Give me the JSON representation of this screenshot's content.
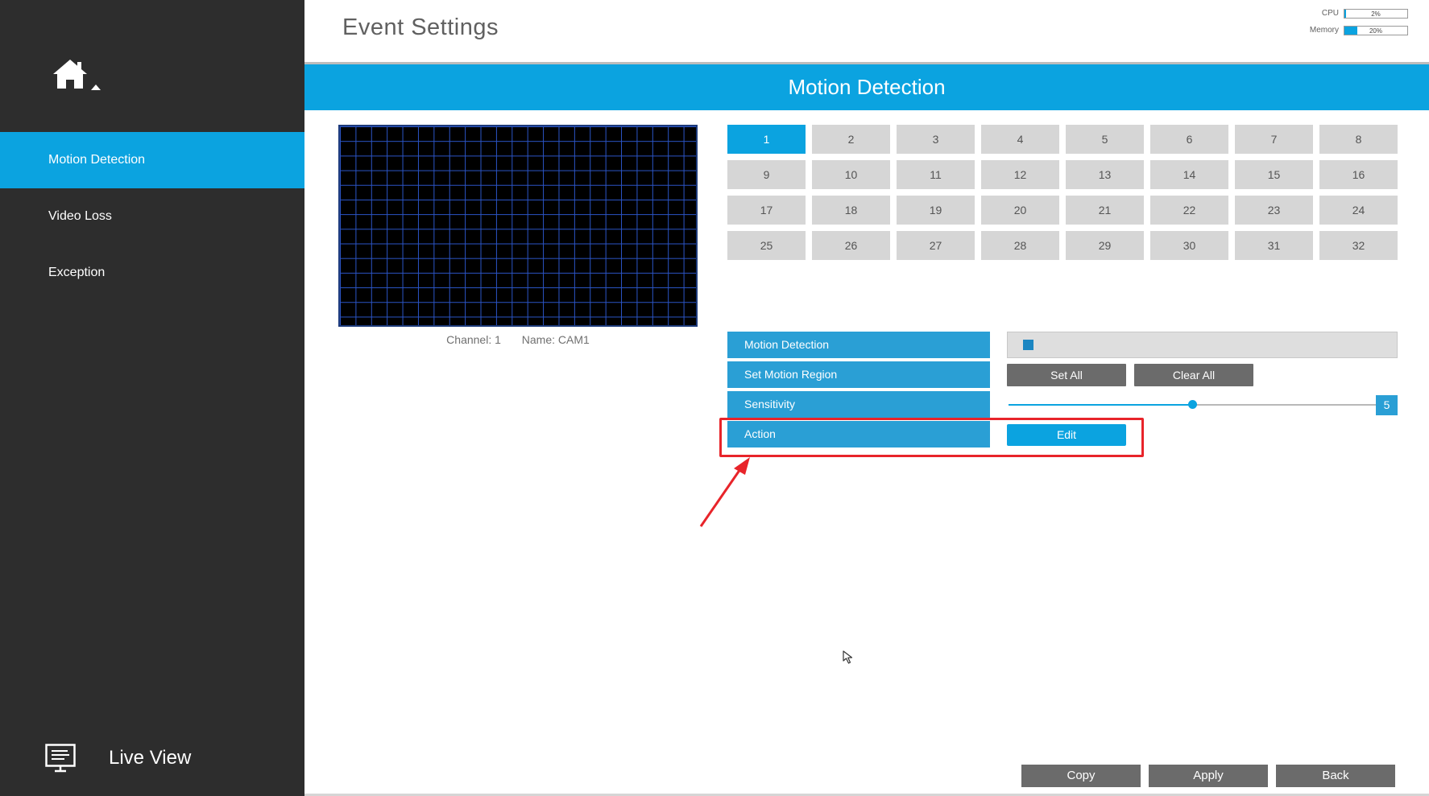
{
  "sidebar": {
    "home_icon": "home-icon",
    "items": [
      {
        "label": "Motion Detection",
        "active": true
      },
      {
        "label": "Video Loss",
        "active": false
      },
      {
        "label": "Exception",
        "active": false
      }
    ],
    "live_view": {
      "label": "Live View",
      "icon": "monitor-icon"
    }
  },
  "header": {
    "title": "Event Settings",
    "cpu": {
      "label": "CPU",
      "value": "2%",
      "level": 0.02
    },
    "memory": {
      "label": "Memory",
      "value": "20%",
      "level": 0.2
    }
  },
  "section": {
    "title": "Motion Detection"
  },
  "preview": {
    "channel_label": "Channel: 1",
    "name_label": "Name: CAM1"
  },
  "channels": {
    "selected": 1,
    "items": [
      "1",
      "2",
      "3",
      "4",
      "5",
      "6",
      "7",
      "8",
      "9",
      "10",
      "11",
      "12",
      "13",
      "14",
      "15",
      "16",
      "17",
      "18",
      "19",
      "20",
      "21",
      "22",
      "23",
      "24",
      "25",
      "26",
      "27",
      "28",
      "29",
      "30",
      "31",
      "32"
    ]
  },
  "settings": {
    "motion_detection": {
      "label": "Motion Detection",
      "enabled": true
    },
    "set_motion_region": {
      "label": "Set Motion Region",
      "set_all": "Set All",
      "clear_all": "Clear All"
    },
    "sensitivity": {
      "label": "Sensitivity",
      "value": "5",
      "level": 0.5
    },
    "action": {
      "label": "Action",
      "edit": "Edit"
    }
  },
  "footer": {
    "copy": "Copy",
    "apply": "Apply",
    "back": "Back"
  },
  "colors": {
    "accent": "#0ba3e0",
    "sidebar": "#2d2d2d",
    "highlight": "#e8242a"
  }
}
